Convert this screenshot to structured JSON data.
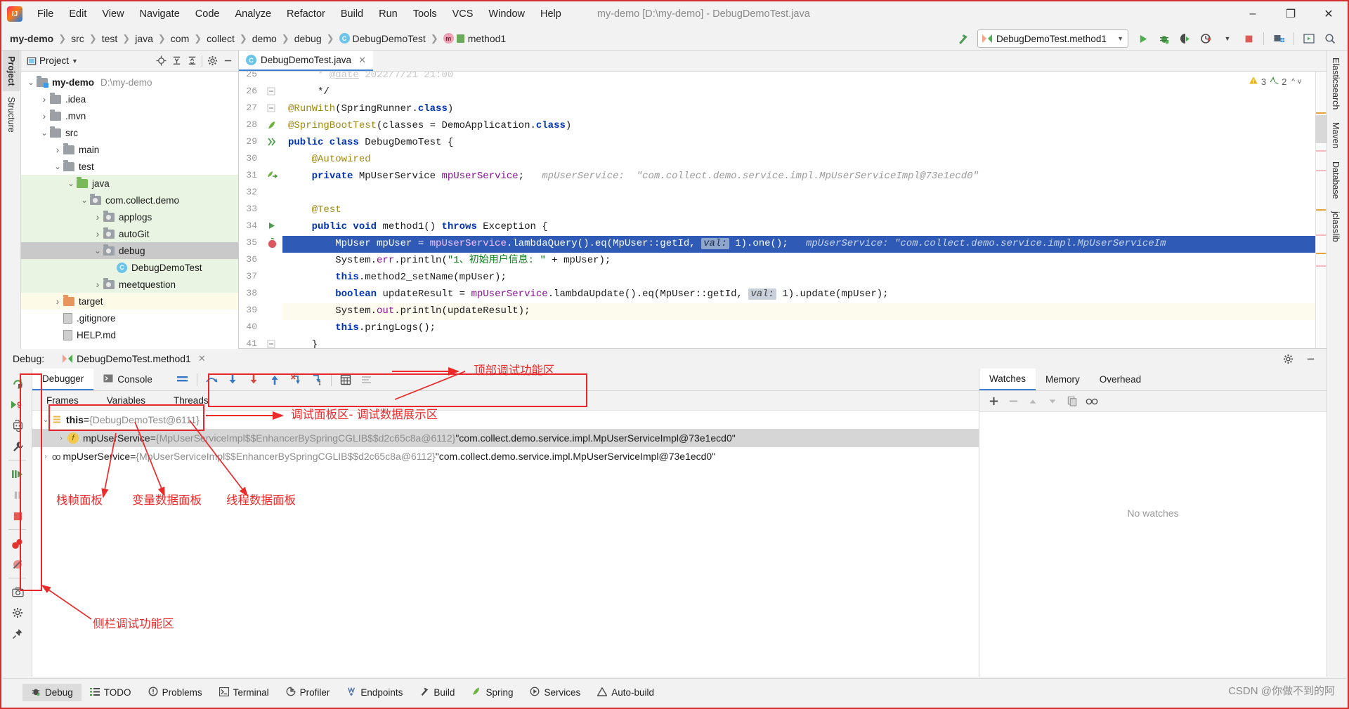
{
  "window": {
    "title": "my-demo [D:\\my-demo] - DebugDemoTest.java",
    "minimize": "–",
    "maximize": "❐",
    "close": "✕"
  },
  "menubar": {
    "logo": "intellij-logo",
    "items": [
      "File",
      "Edit",
      "View",
      "Navigate",
      "Code",
      "Analyze",
      "Refactor",
      "Build",
      "Run",
      "Tools",
      "VCS",
      "Window",
      "Help"
    ]
  },
  "breadcrumb": {
    "items": [
      {
        "label": "my-demo",
        "bold": true,
        "icon": null
      },
      {
        "label": "src",
        "bold": false,
        "icon": null
      },
      {
        "label": "test",
        "bold": false,
        "icon": null
      },
      {
        "label": "java",
        "bold": false,
        "icon": null
      },
      {
        "label": "com",
        "bold": false,
        "icon": null
      },
      {
        "label": "collect",
        "bold": false,
        "icon": null
      },
      {
        "label": "demo",
        "bold": false,
        "icon": null
      },
      {
        "label": "debug",
        "bold": false,
        "icon": null
      },
      {
        "label": "DebugDemoTest",
        "bold": false,
        "icon": "class-icon"
      },
      {
        "label": "method1",
        "bold": false,
        "icon": "method-icon"
      }
    ]
  },
  "runconfig": {
    "name": "DebugDemoTest.method1",
    "dropdown": "▼",
    "build_icon": "hammer-icon",
    "buttons": [
      "run-icon",
      "debug-icon",
      "run-coverage-icon",
      "profiler-icon",
      "dropdown-icon",
      "stop-icon",
      "project-structure-icon",
      "preview-icon",
      "search-icon"
    ]
  },
  "left_strip": {
    "tabs": [
      "Project",
      "Structure"
    ]
  },
  "right_strip": {
    "tabs": [
      "Elasticsearch",
      "Maven",
      "Database",
      "jclasslib"
    ]
  },
  "project_panel": {
    "title": "Project",
    "title_dropdown": "▼",
    "toolbar": [
      "locate-icon",
      "expand-all-icon",
      "collapse-all-icon",
      "gear-icon",
      "hide-icon"
    ],
    "tree": [
      {
        "indent": 0,
        "arrow": "v",
        "icon": "module-folder",
        "label": "my-demo",
        "path": "D:\\my-demo",
        "bold": true,
        "bg": ""
      },
      {
        "indent": 1,
        "arrow": ">",
        "icon": "folder",
        "label": ".idea",
        "path": "",
        "bold": false,
        "bg": ""
      },
      {
        "indent": 1,
        "arrow": ">",
        "icon": "folder",
        "label": ".mvn",
        "path": "",
        "bold": false,
        "bg": ""
      },
      {
        "indent": 1,
        "arrow": "v",
        "icon": "folder",
        "label": "src",
        "path": "",
        "bold": false,
        "bg": ""
      },
      {
        "indent": 2,
        "arrow": ">",
        "icon": "folder",
        "label": "main",
        "path": "",
        "bold": false,
        "bg": ""
      },
      {
        "indent": 2,
        "arrow": "v",
        "icon": "folder",
        "label": "test",
        "path": "",
        "bold": false,
        "bg": ""
      },
      {
        "indent": 3,
        "arrow": "v",
        "icon": "source-folder",
        "label": "java",
        "path": "",
        "bold": false,
        "bg": "green"
      },
      {
        "indent": 4,
        "arrow": "v",
        "icon": "package",
        "label": "com.collect.demo",
        "path": "",
        "bold": false,
        "bg": "green"
      },
      {
        "indent": 5,
        "arrow": ">",
        "icon": "package",
        "label": "applogs",
        "path": "",
        "bold": false,
        "bg": "green"
      },
      {
        "indent": 5,
        "arrow": ">",
        "icon": "package",
        "label": "autoGit",
        "path": "",
        "bold": false,
        "bg": "green"
      },
      {
        "indent": 5,
        "arrow": "v",
        "icon": "package",
        "label": "debug",
        "path": "",
        "bold": false,
        "bg": "gray"
      },
      {
        "indent": 6,
        "arrow": "",
        "icon": "class",
        "label": "DebugDemoTest",
        "path": "",
        "bold": false,
        "bg": "green"
      },
      {
        "indent": 5,
        "arrow": ">",
        "icon": "package",
        "label": "meetquestion",
        "path": "",
        "bold": false,
        "bg": "green"
      },
      {
        "indent": 2,
        "arrow": ">",
        "icon": "target-folder",
        "label": "target",
        "path": "",
        "bold": false,
        "bg": "yellow"
      },
      {
        "indent": 2,
        "arrow": "",
        "icon": "file",
        "label": ".gitignore",
        "path": "",
        "bold": false,
        "bg": ""
      },
      {
        "indent": 2,
        "arrow": "",
        "icon": "file",
        "label": "HELP.md",
        "path": "",
        "bold": false,
        "bg": ""
      }
    ]
  },
  "editor": {
    "tab": {
      "label": "DebugDemoTest.java",
      "icon": "class-icon",
      "close": "✕"
    },
    "inspection_widget": {
      "warnings": "3",
      "warn_icon": "warning-icon",
      "typos": "2",
      "typo_icon": "typo-icon",
      "up": "^",
      "down": "v"
    },
    "first_line_number": 25,
    "lines": [
      {
        "n": 25,
        "gutter": "",
        "html": "     * <u>@date</u> 2022/7/21 21:00",
        "partial": true
      },
      {
        "n": 26,
        "gutter": "fold",
        "html": "     */"
      },
      {
        "n": 27,
        "gutter": "fold",
        "html": "<span class='ann'>@RunWith</span>(SpringRunner.<span class='kw'>class</span>)"
      },
      {
        "n": 28,
        "gutter": "spring",
        "html": "<span class='ann'>@SpringBootTest</span>(classes = DemoApplication.<span class='kw'>class</span>)"
      },
      {
        "n": 29,
        "gutter": "runtests",
        "html": "<span class='kw'>public class </span>DebugDemoTest {"
      },
      {
        "n": 30,
        "gutter": "",
        "html": "    <span class='ann'>@Autowired</span>"
      },
      {
        "n": 31,
        "gutter": "bean",
        "html": "    <span class='kw'>private </span>MpUserService <span class='fld'>mpUserService</span>;   <span class='hint'>mpUserService:  \"com.collect.demo.service.impl.MpUserServiceImpl@73e1ecd0\"</span>"
      },
      {
        "n": 32,
        "gutter": "",
        "html": ""
      },
      {
        "n": 33,
        "gutter": "",
        "html": "    <span class='ann'>@Test</span>"
      },
      {
        "n": 34,
        "gutter": "runmethod",
        "html": "    <span class='kw'>public void </span>method1() <span class='kw'>throws </span>Exception {"
      },
      {
        "n": 35,
        "gutter": "breakpoint",
        "highlight": true,
        "html": "        MpUser mpUser = <span class='fld'>mpUserService</span>.lambdaQuery().eq(MpUser::getId, <span class='valchip'>val:</span> 1).one();   <span class='hint'>mpUserService: \"com.collect.demo.service.impl.MpUserServiceIm</span>"
      },
      {
        "n": 36,
        "gutter": "",
        "html": "        System.<span class='fld'>err</span>.println(<span class='str'>\"1、初始用户信息: \"</span> + mpUser);"
      },
      {
        "n": 37,
        "gutter": "",
        "html": "        <span class='kw'>this</span>.method2_setName(mpUser);"
      },
      {
        "n": 38,
        "gutter": "",
        "html": "        <span class='kw'>boolean </span>updateResult = <span class='fld'>mpUserService</span>.lambdaUpdate().eq(MpUser::getId, <span class='valchip'>val:</span> 1).update(mpUser);"
      },
      {
        "n": 39,
        "gutter": "",
        "highlight2": true,
        "html": "        System.<span class='fld'>out</span>.println(updateResult);"
      },
      {
        "n": 40,
        "gutter": "",
        "html": "        <span class='kw'>this</span>.pringLogs();"
      },
      {
        "n": 41,
        "gutter": "fold",
        "html": "    }"
      }
    ]
  },
  "debug_window": {
    "header_label": "Debug:",
    "session_tab": "DebugDemoTest.method1",
    "session_close": "✕",
    "settings_icon": "gear-icon",
    "hide_icon": "minimize-icon",
    "layout_icon": "layout-icon",
    "side_toolbar": [
      "rerun-icon",
      "resume-icon",
      "restore-layout-icon",
      "settings-wrench-icon",
      "step-over-run-icon",
      "pause-icon",
      "stop-icon",
      "view-breakpoints-icon",
      "mute-breakpoints-icon",
      "camera-icon",
      "settings-gear-icon",
      "pin-icon"
    ],
    "tabs": [
      {
        "label": "Debugger",
        "selected": true,
        "icon": null
      },
      {
        "label": "Console",
        "selected": false,
        "icon": "console-icon"
      }
    ],
    "toolbar_icons": [
      "show-frames-icon",
      "step-over-icon",
      "step-into-icon",
      "force-step-into-icon",
      "step-out-icon",
      "drop-frame-icon",
      "run-to-cursor-icon",
      "evaluate-expression-icon",
      "settings-icon"
    ],
    "panes": [
      "Frames",
      "Variables",
      "Threads"
    ],
    "variables": [
      {
        "indent": 0,
        "arrow": "v",
        "icon": "list-icon",
        "name": "this",
        "bold": true,
        "eq": " = ",
        "type": "{DebugDemoTest@6111}",
        "value": "",
        "selected": false
      },
      {
        "indent": 1,
        "arrow": ">",
        "icon": "field-icon",
        "name": "mpUserService",
        "bold": false,
        "eq": " = ",
        "type": "{MpUserServiceImpl$$EnhancerBySpringCGLIB$$d2c65c8a@6112}",
        "value": "\"com.collect.demo.service.impl.MpUserServiceImpl@73e1ecd0\"",
        "selected": true
      },
      {
        "indent": 0,
        "arrow": ">",
        "icon": "oo-icon",
        "name": "mpUserService",
        "bold": false,
        "eq": " = ",
        "type": "{MpUserServiceImpl$$EnhancerBySpringCGLIB$$d2c65c8a@6112}",
        "value": "\"com.collect.demo.service.impl.MpUserServiceImpl@73e1ecd0\"",
        "selected": false
      }
    ],
    "watches": {
      "tabs": [
        {
          "label": "Watches",
          "selected": true
        },
        {
          "label": "Memory",
          "selected": false
        },
        {
          "label": "Overhead",
          "selected": false
        }
      ],
      "toolbar": [
        "add-icon",
        "remove-icon",
        "move-up-icon",
        "move-down-icon",
        "copy-icon",
        "glasses-icon"
      ],
      "empty_text": "No watches"
    }
  },
  "statusbar": {
    "items": [
      {
        "label": "Debug",
        "icon": "debug-icon",
        "selected": true
      },
      {
        "label": "TODO",
        "icon": "todo-icon",
        "selected": false
      },
      {
        "label": "Problems",
        "icon": "problems-icon",
        "selected": false
      },
      {
        "label": "Terminal",
        "icon": "terminal-icon",
        "selected": false
      },
      {
        "label": "Profiler",
        "icon": "profiler-icon",
        "selected": false
      },
      {
        "label": "Endpoints",
        "icon": "endpoints-icon",
        "selected": false
      },
      {
        "label": "Build",
        "icon": "build-icon",
        "selected": false
      },
      {
        "label": "Spring",
        "icon": "spring-icon",
        "selected": false
      },
      {
        "label": "Services",
        "icon": "services-icon",
        "selected": false
      },
      {
        "label": "Auto-build",
        "icon": "autobuild-icon",
        "selected": false
      }
    ],
    "watermark": "CSDN @你做不到的阿"
  },
  "annotations": {
    "color": "#ec2a2a",
    "labels": [
      {
        "id": "top-debug-area",
        "text": "顶部调试功能区"
      },
      {
        "id": "debug-panel-area",
        "text": "调试面板区- 调试数据展示区"
      },
      {
        "id": "frames-panel",
        "text": "栈帧面板"
      },
      {
        "id": "variables-panel",
        "text": "变量数据面板"
      },
      {
        "id": "threads-panel",
        "text": "线程数据面板"
      },
      {
        "id": "side-debug-area",
        "text": "侧栏调试功能区"
      }
    ]
  }
}
